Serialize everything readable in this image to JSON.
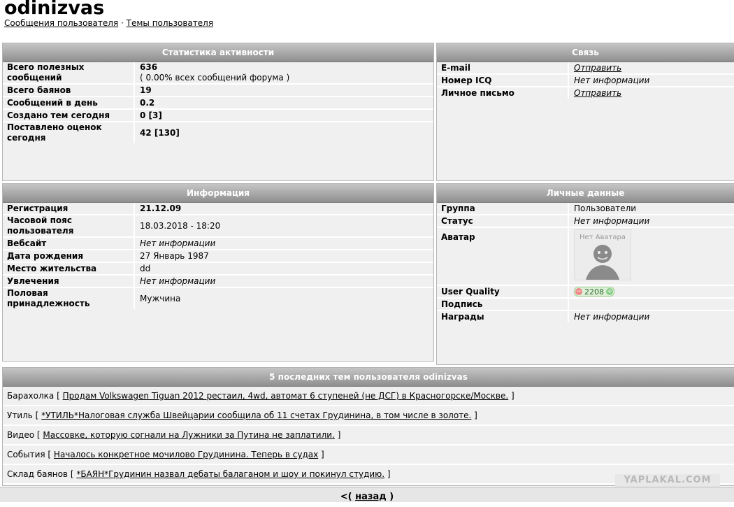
{
  "header": {
    "username": "odinizvas",
    "links": [
      "Сообщения пользователя",
      "Темы пользователя"
    ],
    "separator": "·"
  },
  "activity": {
    "title": "Статистика активности",
    "rows": [
      {
        "label": "Всего полезных сообщений",
        "value": "636",
        "sub": "( 0.00% всех сообщений форума )"
      },
      {
        "label": "Всего баянов",
        "value": "19"
      },
      {
        "label": "Сообщений в день",
        "value": "0.2"
      },
      {
        "label": "Создано тем сегодня",
        "value": "0 [3]"
      },
      {
        "label": "Поставлено оценок сегодня",
        "value": "42 [130]"
      }
    ]
  },
  "contact": {
    "title": "Связь",
    "rows": [
      {
        "label": "E-mail",
        "value": "Отправить"
      },
      {
        "label": "Номер ICQ",
        "value": "Нет информации"
      },
      {
        "label": "Личное письмо",
        "value": "Отправить"
      }
    ]
  },
  "info": {
    "title": "Информация",
    "rows": [
      {
        "label": "Регистрация",
        "value": "21.12.09"
      },
      {
        "label": "Часовой пояс пользователя",
        "value": "18.03.2018 - 18:20"
      },
      {
        "label": "Вебсайт",
        "value": "Нет информации"
      },
      {
        "label": "Дата рождения",
        "value": "27 Январь 1987"
      },
      {
        "label": "Место жительства",
        "value": "dd"
      },
      {
        "label": "Увлечения",
        "value": "Нет информации"
      },
      {
        "label": "Половая принадлежность",
        "value": "Мужчина"
      }
    ]
  },
  "personal": {
    "title": "Личные данные",
    "rows": [
      {
        "label": "Группа",
        "value": "Пользователи"
      },
      {
        "label": "Статус",
        "value": "Нет информации"
      },
      {
        "label": "Аватар",
        "value": "Нет Аватара"
      },
      {
        "label": "User Quality",
        "value": "2208"
      },
      {
        "label": "Подпись",
        "value": ""
      },
      {
        "label": "Награды",
        "value": "Нет информации"
      }
    ]
  },
  "topics": {
    "title": "5 последних тем пользователя odinizvas",
    "items": [
      {
        "section": "Барахолка",
        "title": "Продам Volkswagen Tiguan 2012 рестаил, 4wd, автомат 6 ступеней (не ДСГ) в Красногорске/Москве."
      },
      {
        "section": "Утиль",
        "title": "*УТИЛЬ*Налоговая служба Швейцарии сообщила об 11 счетах Грудинина, в том числе в золоте."
      },
      {
        "section": "Видео",
        "title": "Массовке, которую согнали на Лужники за Путина не заплатили."
      },
      {
        "section": "События",
        "title": "Началось конкретное мочилово Грудинина. Теперь в судах"
      },
      {
        "section": "Склад баянов",
        "title": "*БАЯН*Грудинин назвал дебаты балаганом и шоу и покинул студию."
      }
    ]
  },
  "footer": {
    "back_prefix": "<(",
    "back_label": "назад",
    "back_suffix": ")"
  },
  "watermark": "YAPLAKAL.COM"
}
